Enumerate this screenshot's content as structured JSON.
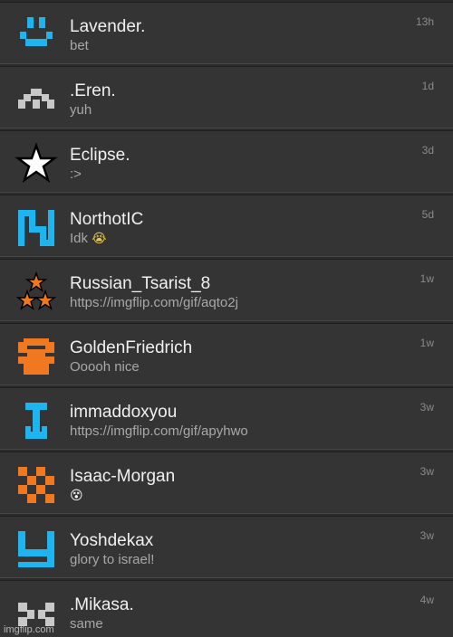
{
  "conversations": [
    {
      "name": "Lavender.",
      "message": "bet",
      "time": "13h",
      "avatar": "lavender-avatar-icon",
      "color": "#1eb4f0"
    },
    {
      "name": ".Eren.",
      "message": "yuh",
      "time": "1d",
      "avatar": "eren-avatar-icon",
      "color": "#c8c8c8"
    },
    {
      "name": "Eclipse.",
      "message": ":>",
      "time": "3d",
      "avatar": "star-avatar-icon",
      "color": "#ffffff"
    },
    {
      "name": "NorthotIC",
      "message": "Idk",
      "emoji": "😭",
      "time": "5d",
      "avatar": "northotic-avatar-icon",
      "color": "#1eb4f0"
    },
    {
      "name": "Russian_Tsarist_8",
      "message": "https://imgflip.com/gif/aqto2j",
      "time": "1w",
      "avatar": "three-stars-avatar-icon",
      "color": "#f07820"
    },
    {
      "name": "GoldenFriedrich",
      "message": "Ooooh nice",
      "time": "1w",
      "avatar": "goldenfriedrich-avatar-icon",
      "color": "#f07820"
    },
    {
      "name": "immaddoxyou",
      "message": "https://imgflip.com/gif/apyhwo",
      "time": "3w",
      "avatar": "immaddoxyou-avatar-icon",
      "color": "#1eb4f0"
    },
    {
      "name": "Isaac-Morgan",
      "message": "",
      "emoji": "😵",
      "time": "3w",
      "avatar": "checker-avatar-icon",
      "color": "#f07820"
    },
    {
      "name": "Yoshdekax",
      "message": "glory to israel!",
      "time": "3w",
      "avatar": "yoshdekax-avatar-icon",
      "color": "#1eb4f0"
    },
    {
      "name": ".Mikasa.",
      "message": "same",
      "time": "4w",
      "avatar": "mikasa-avatar-icon",
      "color": "#c8c8c8"
    }
  ],
  "watermark": "imgflip.com"
}
